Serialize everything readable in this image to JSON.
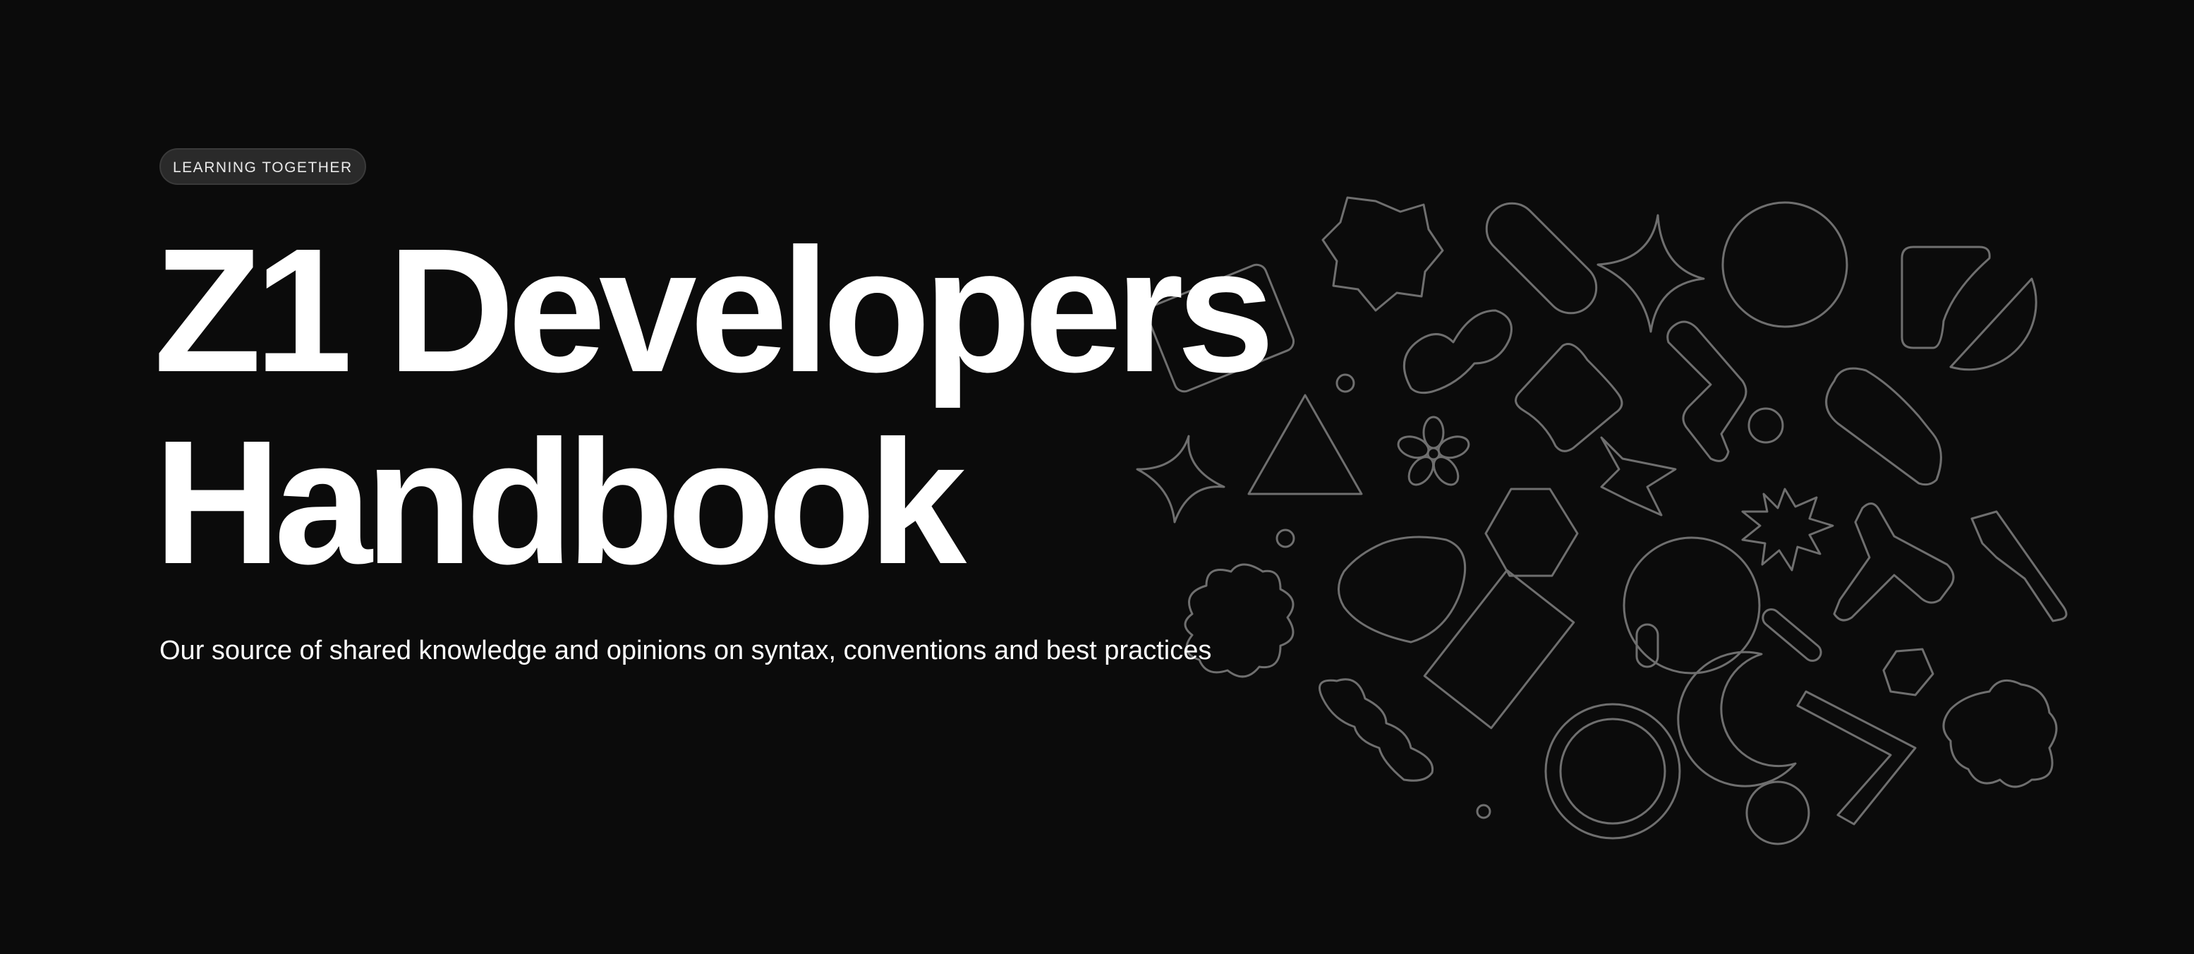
{
  "badge": "LEARNING TOGETHER",
  "title": {
    "line1": "Z1 Developers",
    "line2": "Handbook"
  },
  "subtitle": "Our source of shared knowledge and opinions on syntax, conventions and best practices",
  "colors": {
    "background": "#0b0b0b",
    "text": "#ffffff",
    "badge_bg": "#2a2a2a",
    "shape_stroke": "#6f6f6f"
  }
}
